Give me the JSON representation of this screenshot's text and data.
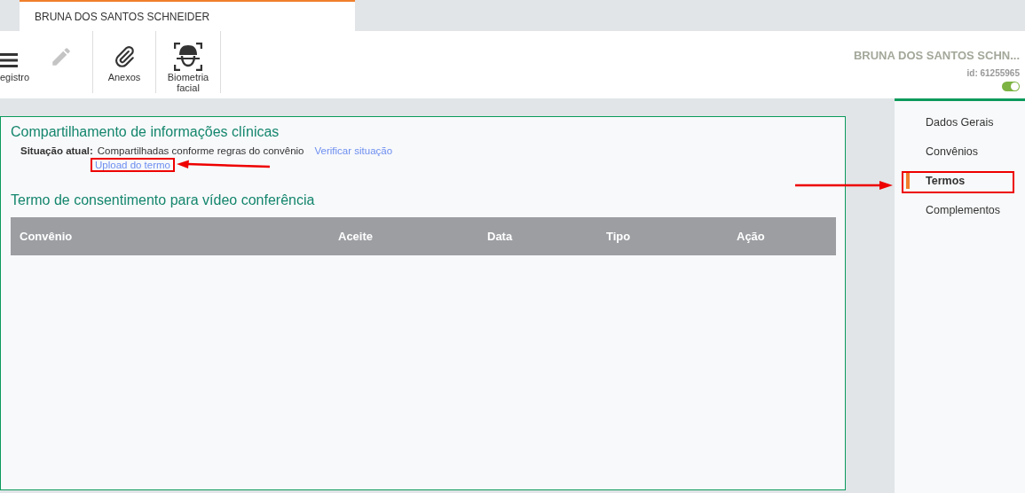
{
  "tab": {
    "title": "BRUNA DOS SANTOS SCHNEIDER",
    "selected": true
  },
  "toolbar": [
    {
      "kind": "menu",
      "label": "egistro",
      "disabled": false
    },
    {
      "kind": "pencil",
      "disabled": true
    },
    {
      "kind": "clip",
      "label": "Anexos",
      "disabled": false
    },
    {
      "kind": "face",
      "label": "Biometria facial",
      "disabled": false
    }
  ],
  "patient": {
    "name": "BRUNA DOS SANTOS SCHN...",
    "id": "id: 61255965",
    "active": true
  },
  "sharing": {
    "title": "Compartilhamento de informações clínicas",
    "status_label": "Situação atual:",
    "status_value": "Compartilhadas conforme regras do convênio",
    "check_link": "Verificar situação",
    "upload_link": "Upload do termo"
  },
  "consent": {
    "title": "Termo de consentimento para vídeo conferência",
    "columns": [
      "Convênio",
      "Aceite",
      "Data",
      "Tipo",
      "Ação"
    ]
  },
  "sidebar": {
    "items": [
      {
        "label": "Dados Gerais",
        "selected": false
      },
      {
        "label": "Convênios",
        "selected": false
      },
      {
        "label": "Termos",
        "selected": true
      },
      {
        "label": "Complementos",
        "selected": false
      }
    ]
  }
}
